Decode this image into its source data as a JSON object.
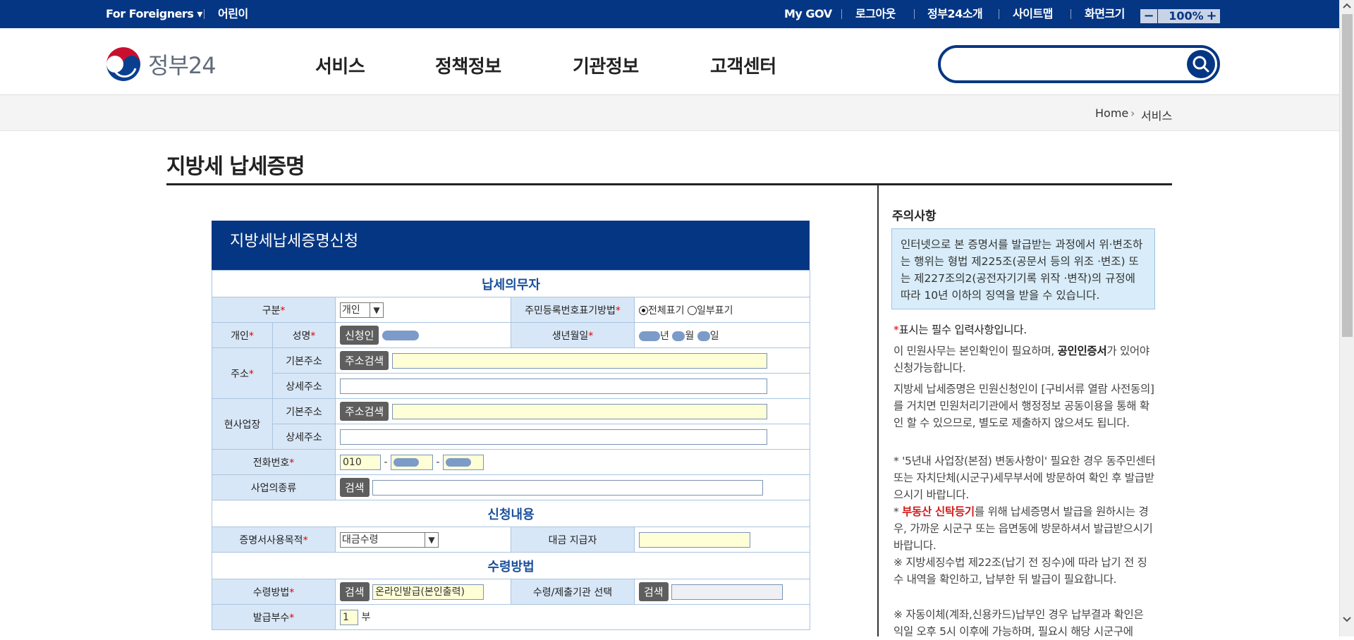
{
  "topbar": {
    "foreigners": "For Foreigners ▾",
    "kids": "어린이",
    "mygov": "My GOV",
    "logout": "로그아웃",
    "about": "정부24소개",
    "sitemap": "사이트맵",
    "screen_size": "화면크기",
    "zoom_minus": "−",
    "zoom_value": "100%",
    "zoom_plus": "+"
  },
  "header": {
    "logo_text": "정부24",
    "nav": [
      "서비스",
      "정책정보",
      "기관정보",
      "고객센터"
    ],
    "search_placeholder": ""
  },
  "breadcrumb": {
    "home": "Home",
    "arrow": "›",
    "current": "서비스"
  },
  "page_title": "지방세 납세증명",
  "form": {
    "heading": "지방세납세증명신청",
    "sec_taxpayer": "납세의무자",
    "gubun_label": "구분",
    "gubun_value": "개인",
    "rrn_label": "주민등록번호표기방법",
    "rrn_opt1": "전체표기",
    "rrn_opt2": "일부표기",
    "personal_label": "개인",
    "name_label": "성명",
    "applicant_btn": "신청인",
    "birth_label": "생년월일",
    "birth_y": "년",
    "birth_m": "월",
    "birth_d": "일",
    "addr_label": "주소",
    "basic_addr": "기본주소",
    "detail_addr": "상세주소",
    "addr_search_btn": "주소검색",
    "workplace_label": "현사업장",
    "phone_label": "전화번호",
    "phone_prefix": "010",
    "dash": "-",
    "biz_type_label": "사업의종류",
    "search_btn": "검색",
    "sec_request": "신청내용",
    "purpose_label": "증명서사용목적",
    "purpose_value": "대금수령",
    "payer_label": "대금 지급자",
    "sec_receive": "수령방법",
    "receive_label": "수령방법",
    "receive_value": "온라인발급(본인출력)",
    "institution_label": "수령/제출기관 선택",
    "copies_label": "발급부수",
    "copies_value": "1",
    "copies_unit": "부"
  },
  "notice": {
    "title": "주의사항",
    "box": "인터넷으로 본 증명서를 발급받는 과정에서 위·변조하는 행위는 형법 제225조(공문서 등의 위조 ·변조) 또는 제227조의2(공전자기기록 위작 ·변작)의 규정에 따라 10년 이하의 징역을 받을 수 있습니다.",
    "required_mark": "*",
    "required_text": "표시는 필수 입력사항입니다.",
    "p2_pre": "이 민원사무는 본인확인이 필요하며, ",
    "p2_bold": "공인인증서",
    "p2_post": "가 있어야 신청가능합니다.",
    "p3": "지방세 납세증명은 민원신청인이 [구비서류 열람 사전동의]를 거치면 민원처리기관에서 행정정보 공동이용을 통해 확인 할 수 있으므로, 별도로 제출하지 않으셔도 됩니다.",
    "p4": " * '5년내 사업장(본점) 변동사항이' 필요한 경우 동주민센터 또는 자치단체(시군구)세무부서에 방문하여 확인 후 발급받으시기 바랍니다.",
    "p5_pre": " * ",
    "p5_red": "부동산 신탁등기",
    "p5_post": "를 위해 납세증명서 발급을 원하시는 경우, 가까운 시군구 또는 읍면동에 방문하셔서 발급받으시기 바랍니다.",
    "p6": "※ 지방세징수법 제22조(납기 전 징수)에 따라 납기 전 징수 내역을 확인하고, 납부한 뒤 발급이 필요합니다.",
    "p7": "※ 자동이체(계좌,신용카드)납부인 경우 납부결과 확인은 익일 오후 5시 이후에 가능하며, 필요시 해당 시군구에"
  },
  "colors": {
    "brand": "#053683",
    "label_bg": "#d8e7f7",
    "required": "#d00000"
  }
}
